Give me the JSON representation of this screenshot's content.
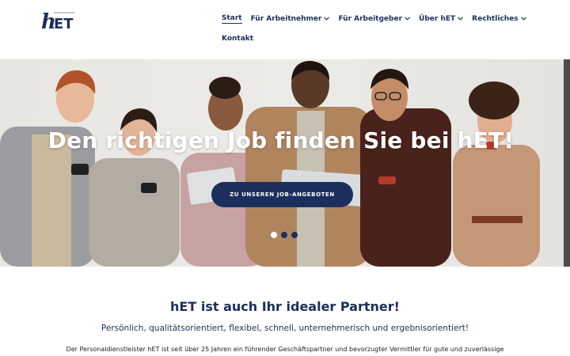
{
  "brand": {
    "logo_text": "hET",
    "primary_color": "#1c2f5c"
  },
  "nav": {
    "items": [
      {
        "label": "Start",
        "active": true,
        "dropdown": false
      },
      {
        "label": "Für Arbeitnehmer",
        "active": false,
        "dropdown": true
      },
      {
        "label": "Für Arbeitgeber",
        "active": false,
        "dropdown": true
      },
      {
        "label": "Über hET",
        "active": false,
        "dropdown": true
      },
      {
        "label": "Rechtliches",
        "active": false,
        "dropdown": true
      },
      {
        "label": "Kontakt",
        "active": false,
        "dropdown": false
      }
    ]
  },
  "hero": {
    "title": "Den richtigen Job finden Sie bei hET!",
    "button_label": "ZU UNSEREN JOB-ANGEBOTEN",
    "slides_count": 3,
    "active_slide": 1
  },
  "intro": {
    "title": "hET ist auch Ihr idealer Partner!",
    "subtitle": "Persönlich, qualitätsorientiert, flexibel, schnell, unternehmerisch und ergebnisorientiert!",
    "text": "Der Personaldienstleister hET ist seit über 25 Jahren ein führender Geschäftspartner und bevorzugter Vermittler für gute und zuverlässige"
  }
}
